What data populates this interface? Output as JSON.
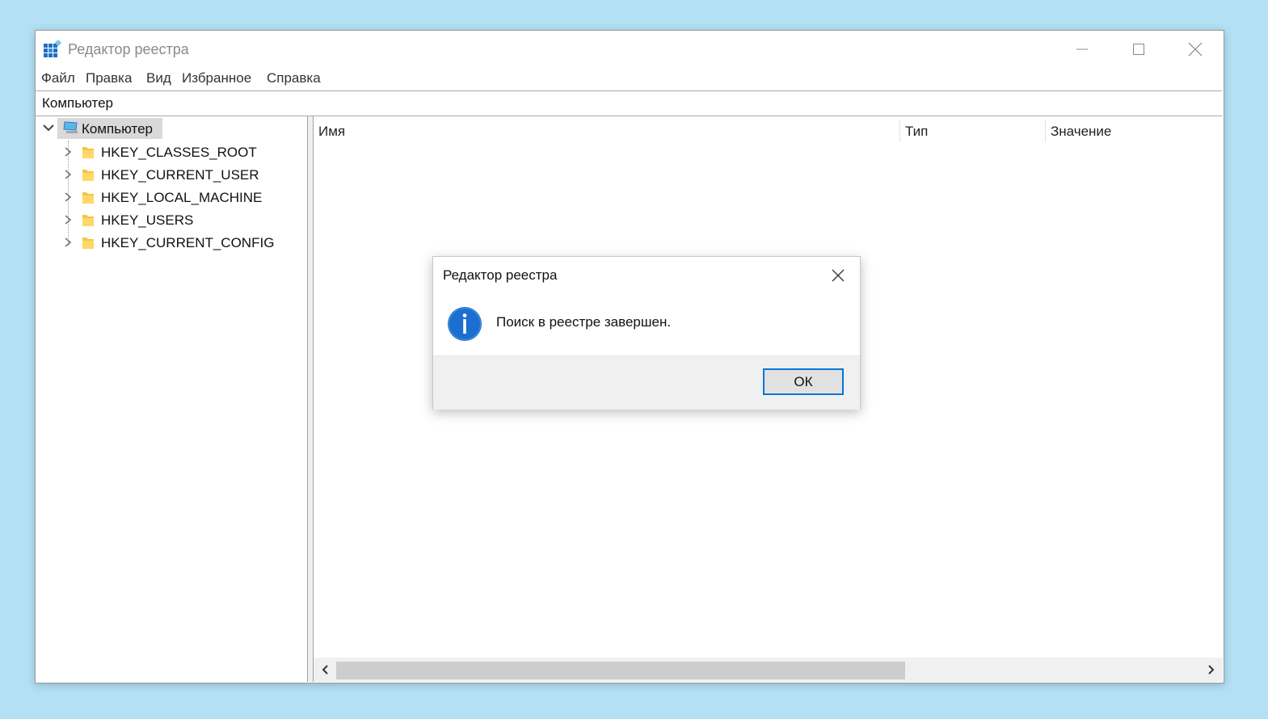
{
  "window": {
    "title": "Редактор реестра"
  },
  "menu": [
    {
      "label": "Файл"
    },
    {
      "label": "Правка"
    },
    {
      "label": "Вид"
    },
    {
      "label": "Избранное"
    },
    {
      "label": "Справка"
    }
  ],
  "address": "Компьютер",
  "tree": {
    "root": {
      "label": "Компьютер",
      "expanded": true,
      "selected": true,
      "icon": "computer-icon"
    },
    "children": [
      {
        "label": "HKEY_CLASSES_ROOT",
        "icon": "folder-icon"
      },
      {
        "label": "HKEY_CURRENT_USER",
        "icon": "folder-icon"
      },
      {
        "label": "HKEY_LOCAL_MACHINE",
        "icon": "folder-icon"
      },
      {
        "label": "HKEY_USERS",
        "icon": "folder-icon"
      },
      {
        "label": "HKEY_CURRENT_CONFIG",
        "icon": "folder-icon"
      }
    ]
  },
  "list": {
    "columns": [
      {
        "label": "Имя"
      },
      {
        "label": "Тип"
      },
      {
        "label": "Значение"
      }
    ]
  },
  "dialog": {
    "title": "Редактор реестра",
    "icon": "info-icon",
    "message": "Поиск в реестре завершен.",
    "ok_label": "ОК"
  },
  "colors": {
    "desktop": "#b3e0f5",
    "accent": "#0078d7",
    "folder": "#f5c542",
    "info": "#1a6fd0"
  }
}
